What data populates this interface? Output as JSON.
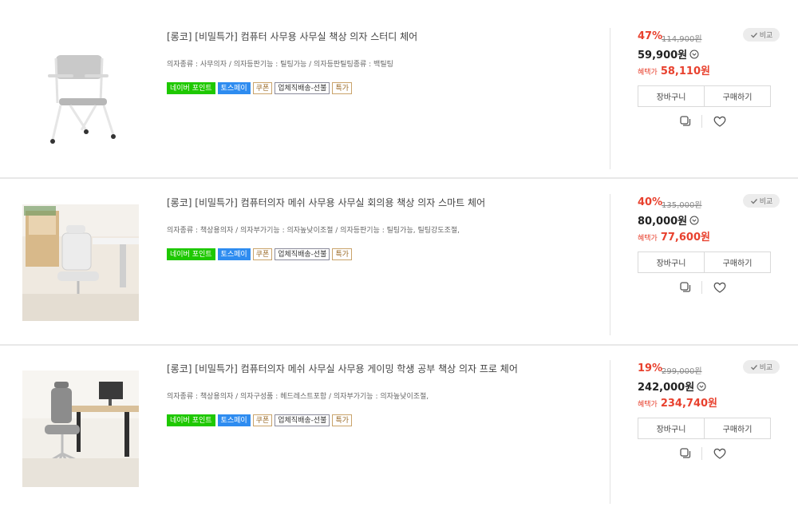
{
  "products": [
    {
      "title": "[롱코] [비밀특가] 컴퓨터 사무용 사무실 책상 의자 스터디 체어",
      "specs": "의자종류 : 사무의자 / 의자등판기능 : 틸팅가능 / 의자등판틸팅종류 : 백틸팅",
      "discount": "47%",
      "original_price": "114,900원",
      "price": "59,900원",
      "benefit_label": "혜택가",
      "benefit_price": "58,110원"
    },
    {
      "title": "[롱코] [비밀특가] 컴퓨터의자 메쉬 사무용 사무실 회의용 책상 의자 스마트 체어",
      "specs": "의자종류 : 책상용의자 / 의자부가기능 : 의자높낮이조절 / 의자등판기능 : 틸팅가능, 틸팅강도조절,",
      "discount": "40%",
      "original_price": "135,000원",
      "price": "80,000원",
      "benefit_label": "혜택가",
      "benefit_price": "77,600원"
    },
    {
      "title": "[롱코] [비밀특가] 컴퓨터의자 메쉬 사무실 사무용 게이밍 학생 공부 책상 의자 프로 체어",
      "specs": "의자종류 : 책상용의자 / 의자구성품 : 헤드레스트포함 / 의자부가기능 : 의자높낮이조절,",
      "discount": "19%",
      "original_price": "299,000원",
      "price": "242,000원",
      "benefit_label": "혜택가",
      "benefit_price": "234,740원"
    }
  ],
  "badges": {
    "naver": "네이버 포인트",
    "toss": "토스페이",
    "coupon": "쿠폰",
    "shipping": "업체직배송-선불",
    "special": "특가"
  },
  "labels": {
    "compare": "비교",
    "cart": "장바구니",
    "buy": "구매하기"
  },
  "icons": {
    "compare": "check-icon",
    "price_info": "chevron-down-circle-icon",
    "duplicate": "duplicate-icon",
    "wishlist": "heart-icon"
  },
  "colors": {
    "discount": "#e8412e",
    "naver_badge": "#1ec800",
    "toss_badge": "#2e8cf0"
  }
}
